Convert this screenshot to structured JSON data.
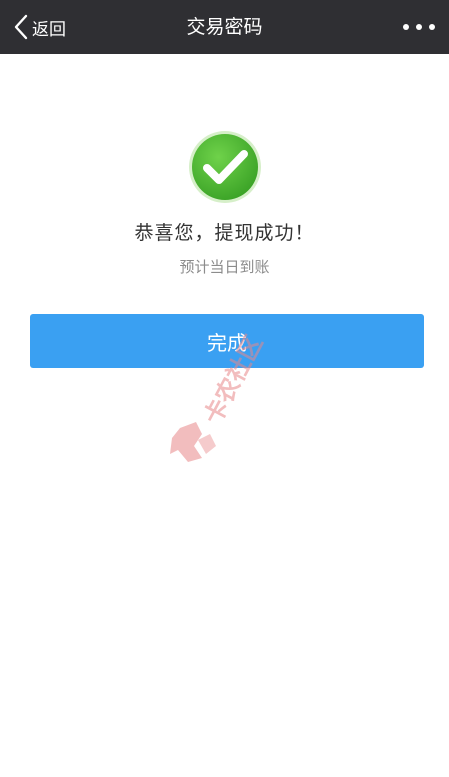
{
  "navbar": {
    "back_label": "返回",
    "title": "交易密码",
    "back_icon": "chevron-left-icon",
    "more_icon": "more-dots-icon"
  },
  "result": {
    "icon": "check-circle-icon",
    "headline": "恭喜您，提现成功！",
    "subline": "预计当日到账"
  },
  "actions": {
    "done_label": "完成"
  },
  "watermark": {
    "text": "卡农社区"
  },
  "colors": {
    "navbar_bg": "#2f2f33",
    "success_green": "#4dbb2f",
    "button_blue": "#3aa0f2",
    "watermark_red": "#e8888a"
  }
}
